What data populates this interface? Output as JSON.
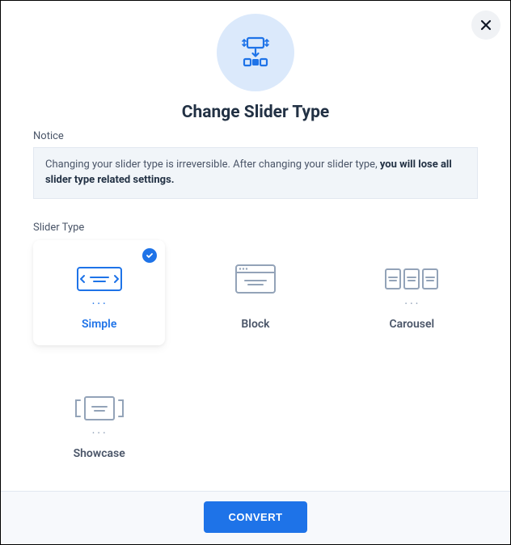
{
  "header": {
    "title": "Change Slider Type"
  },
  "notice": {
    "label": "Notice",
    "text_before": "Changing your slider type is irreversible. After changing your slider type, ",
    "text_bold": "you will lose all slider type related settings."
  },
  "slider_type": {
    "label": "Slider Type",
    "options": [
      {
        "label": "Simple"
      },
      {
        "label": "Block"
      },
      {
        "label": "Carousel"
      },
      {
        "label": "Showcase"
      }
    ]
  },
  "footer": {
    "convert_label": "CONVERT"
  }
}
